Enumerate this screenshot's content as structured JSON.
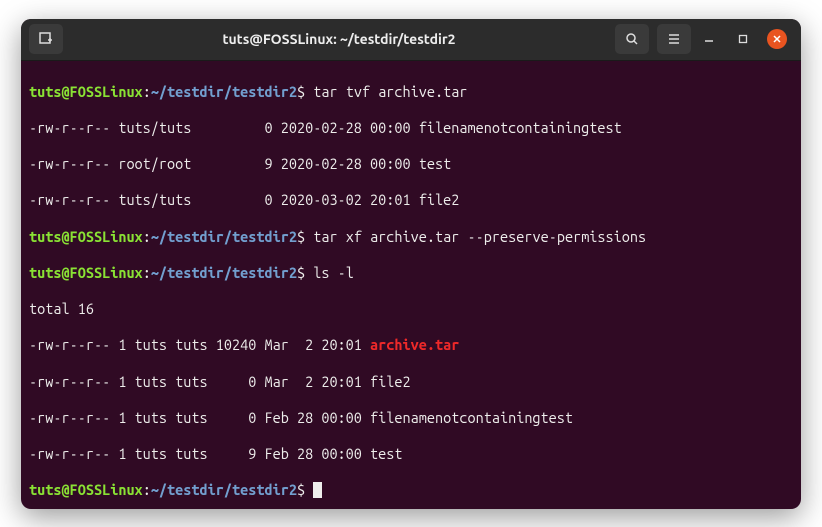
{
  "window": {
    "title": "tuts@FOSSLinux: ~/testdir/testdir2"
  },
  "prompt": {
    "user": "tuts@FOSSLinux",
    "colon": ":",
    "path": "~/testdir/testdir2",
    "dollar": "$"
  },
  "commands": {
    "c1": " tar tvf archive.tar",
    "c2": " tar xf archive.tar --preserve-permissions",
    "c3": " ls -l",
    "c4": " "
  },
  "output": {
    "tar1": "-rw-r--r-- tuts/tuts         0 2020-02-28 00:00 filenamenotcontainingtest",
    "tar2": "-rw-r--r-- root/root         9 2020-02-28 00:00 test",
    "tar3": "-rw-r--r-- tuts/tuts         0 2020-03-02 20:01 file2",
    "total": "total 16",
    "ls1_a": "-rw-r--r-- 1 tuts tuts 10240 Mar  2 20:01 ",
    "ls1_b": "archive.tar",
    "ls2": "-rw-r--r-- 1 tuts tuts     0 Mar  2 20:01 file2",
    "ls3": "-rw-r--r-- 1 tuts tuts     0 Feb 28 00:00 filenamenotcontainingtest",
    "ls4": "-rw-r--r-- 1 tuts tuts     9 Feb 28 00:00 test"
  }
}
